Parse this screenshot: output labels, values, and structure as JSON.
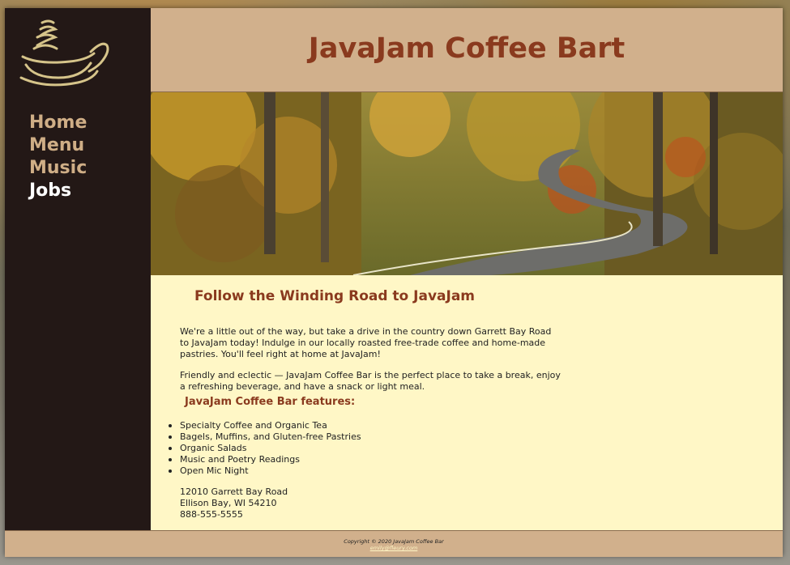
{
  "brand": {
    "title": "JavaJam Coffee Bart"
  },
  "nav": {
    "items": [
      {
        "label": "Home"
      },
      {
        "label": "Menu"
      },
      {
        "label": "Music"
      },
      {
        "label": "Jobs"
      }
    ],
    "active": "Jobs"
  },
  "hero": {
    "image": "winding-autumn-road"
  },
  "content": {
    "heading": "Follow the Winding Road to JavaJam",
    "para1": "We're a little out of the way, but take a drive in the country down Garrett Bay Road to JavaJam today! Indulge in our locally roasted free-trade coffee and home-made pastries. You'll feel right at home at JavaJam!",
    "para2": "Friendly and eclectic — JavaJam Coffee Bar is the perfect place to take a break, enjoy a refreshing beverage, and have a snack or light meal.",
    "features_heading": "JavaJam Coffee Bar features:",
    "features": [
      "Specialty Coffee and Organic Tea",
      "Bagels, Muffins, and Gluten-free Pastries",
      "Organic Salads",
      "Music and Poetry Readings",
      "Open Mic Night"
    ],
    "address": {
      "street": "12010 Garrett Bay Road",
      "city": "Ellison Bay, WI 54210",
      "phone": "888-555-5555"
    }
  },
  "footer": {
    "copyright": "Copyright © 2020 JavaJam Coffee Bar",
    "email": "emily@fleury.com"
  },
  "colors": {
    "sidebar": "#231816",
    "header": "#d1b08c",
    "content_bg": "#fff7c6",
    "accent": "#8a3a1e",
    "nav_link": "#cfae86",
    "nav_active": "#ffffff"
  }
}
